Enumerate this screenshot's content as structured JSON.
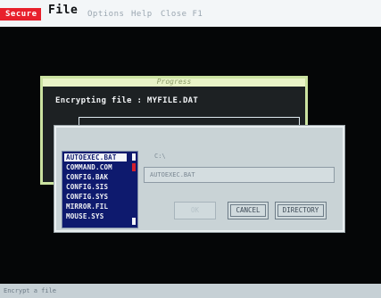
{
  "menubar": {
    "items": [
      {
        "label": "Secure"
      },
      {
        "label": "File"
      },
      {
        "label": "Options"
      },
      {
        "label": "Help"
      },
      {
        "label": "Close F1"
      }
    ]
  },
  "progress": {
    "title": "Progress",
    "encrypt_label": "Encrypting file : MYFILE.DAT"
  },
  "file_dialog": {
    "path_label": "C:\\",
    "filename_value": "AUTOEXEC.BAT",
    "files": [
      "AUTOEXEC.BAT",
      "COMMAND.COM",
      "CONFIG.BAK",
      "CONFIG.SIS",
      "CONFIG.SYS",
      "MIRROR.FIL",
      "MOUSE.SYS"
    ],
    "selected_index": 0,
    "buttons": {
      "ok": "OK",
      "cancel": "CANCEL",
      "directory": "DIRECTORY"
    }
  },
  "status": {
    "text": "Encrypt a file"
  },
  "colors": {
    "menu_accent": "#e8202c",
    "list_background": "#0e1a6e",
    "dialog_background": "#c9d3d6",
    "progress_border": "#cbe2a0"
  }
}
